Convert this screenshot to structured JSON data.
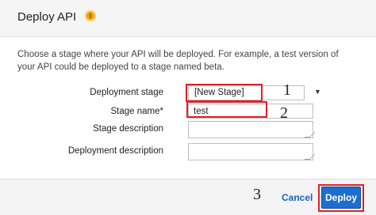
{
  "header": {
    "title": "Deploy API",
    "info_icon": "info-icon"
  },
  "description": "Choose a stage where your API will be deployed. For example, a test version of your API could be deployed to a stage named beta.",
  "form": {
    "deployment_stage": {
      "label": "Deployment stage",
      "value": "[New Stage]"
    },
    "stage_name": {
      "label": "Stage name*",
      "value": "test"
    },
    "stage_description": {
      "label": "Stage description",
      "value": ""
    },
    "deployment_description": {
      "label": "Deployment description",
      "value": ""
    }
  },
  "annotations": {
    "step1": "1",
    "step2": "2",
    "step3": "3"
  },
  "footer": {
    "cancel_label": "Cancel",
    "deploy_label": "Deploy"
  },
  "colors": {
    "highlight": "#e0202a",
    "primary_button": "#1d6fcf",
    "link": "#1a64b4",
    "info_icon": "#f0a000"
  }
}
